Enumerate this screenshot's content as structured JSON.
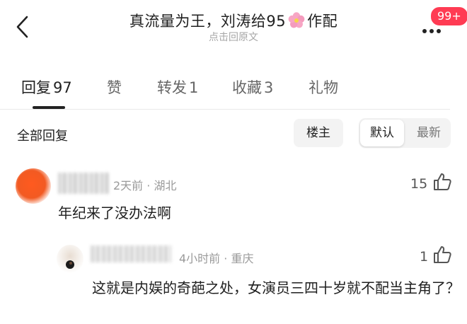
{
  "header": {
    "title_before": "真流量为王，刘涛给95",
    "title_after": "作配",
    "subtitle": "点击回原文",
    "badge": "99+"
  },
  "tabs": [
    {
      "label": "回复",
      "count": "97"
    },
    {
      "label": "赞",
      "count": ""
    },
    {
      "label": "转发",
      "count": "1"
    },
    {
      "label": "收藏",
      "count": "3"
    },
    {
      "label": "礼物",
      "count": ""
    }
  ],
  "filter": {
    "all_label": "全部回复",
    "op_label": "楼主",
    "sort_default": "默认",
    "sort_newest": "最新"
  },
  "comments": [
    {
      "time": "2天前",
      "location": "湖北",
      "meta_sep": " · ",
      "text": "年纪来了没办法啊",
      "likes": "15"
    },
    {
      "time": "4小时前",
      "location": "重庆",
      "meta_sep": " · ",
      "text": "这就是内娱的奇葩之处，女演员三四十岁就不配当主角了？",
      "likes": "1"
    }
  ],
  "colors": {
    "badge": "#ff3b53",
    "accent_text": "#222222",
    "muted": "#9a9a9a"
  }
}
